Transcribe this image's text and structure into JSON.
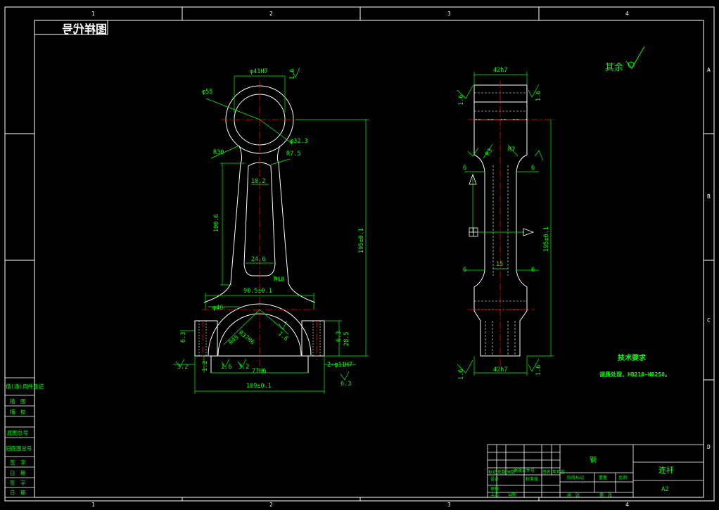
{
  "drawing": {
    "title_code_mirrored": "图样代号",
    "title": "连杆",
    "material": "钢",
    "sheet_size": "A2",
    "roughness_note": "其余",
    "tech_title": "技术要求",
    "tech_note": "调质处理，HB210~HB250。"
  },
  "border": {
    "zones_top": [
      "1",
      "2",
      "3",
      "4"
    ],
    "zones_bottom": [
      "1",
      "2",
      "3",
      "4"
    ],
    "zones_side": [
      "A",
      "B",
      "C",
      "D"
    ]
  },
  "left_margin_table": [
    "借(通)用件登记",
    "旧底图总号",
    "描　图",
    "描　校",
    "底图总号",
    "签　字",
    "日　期",
    "签　字",
    "日　期"
  ],
  "title_block": {
    "row_labels": [
      "标记",
      "处数",
      "分区",
      "更改文件号",
      "签名",
      "年月日"
    ],
    "role_labels": [
      "设计",
      "标准化",
      "审核",
      "工艺",
      "日期"
    ],
    "stage_labels": [
      "阶段标记",
      "重量",
      "比例"
    ],
    "sheet_labels": [
      "共　张",
      "第　张"
    ]
  },
  "front_view": {
    "dims": [
      "φ41H7",
      "1.6",
      "φ55",
      "φ32.3",
      "R30",
      "R7.5",
      "18.2",
      "100.6",
      "195±0.1",
      "24.6",
      "R10",
      "90.5±0.1",
      "φ46",
      "R37H6",
      "1.6",
      "R45",
      "6.3",
      "28.5",
      "6.3",
      "3.2",
      "1.2",
      "1.6",
      "3.2",
      "77H6",
      "2-φ11H7",
      "6.3",
      "109±0.1"
    ]
  },
  "side_view": {
    "dims": [
      "42h7",
      "1.6",
      "1.6",
      "R3",
      "R7",
      "6",
      "6",
      "195±0.1",
      "6",
      "15",
      "6",
      "42h7",
      "1.6",
      "1.6"
    ]
  }
}
